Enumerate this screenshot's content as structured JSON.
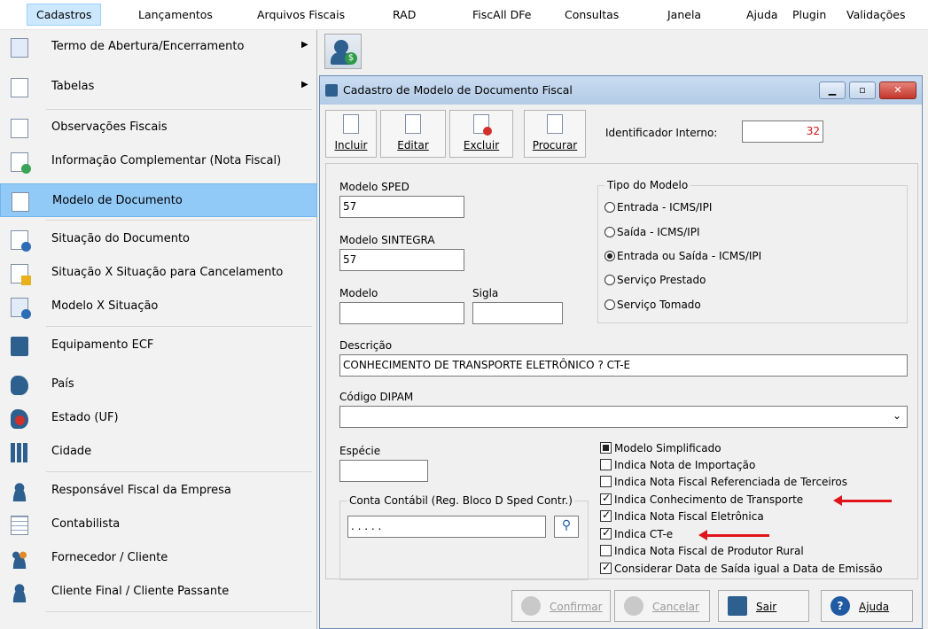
{
  "menubar": {
    "items": [
      "Cadastros",
      "Lançamentos",
      "Arquivos Fiscais",
      "RAD",
      "FiscAll DFe",
      "Consultas",
      "Janela",
      "Ajuda",
      "Plugin",
      "Validações"
    ]
  },
  "menu": {
    "items": [
      {
        "label": "Termo de Abertura/Encerramento"
      },
      {
        "label": "Tabelas"
      },
      {
        "label": "Observações Fiscais"
      },
      {
        "label": "Informação Complementar (Nota Fiscal)"
      },
      {
        "label": "Modelo de Documento"
      },
      {
        "label": "Situação do Documento"
      },
      {
        "label": "Situação X Situação para Cancelamento"
      },
      {
        "label": "Modelo X Situação"
      },
      {
        "label": "Equipamento ECF"
      },
      {
        "label": "País"
      },
      {
        "label": "Estado (UF)"
      },
      {
        "label": "Cidade"
      },
      {
        "label": "Responsável Fiscal da Empresa"
      },
      {
        "label": "Contabilista"
      },
      {
        "label": "Fornecedor / Cliente"
      },
      {
        "label": "Cliente Final / Cliente Passante"
      }
    ]
  },
  "dialog": {
    "title": "Cadastro de Modelo de Documento Fiscal",
    "toolbar": {
      "incluir": "Incluir",
      "editar": "Editar",
      "excluir": "Excluir",
      "procurar": "Procurar"
    },
    "identificador_label": "Identificador Interno:",
    "identificador_value": "32",
    "modelo_sped_label": "Modelo SPED",
    "modelo_sped_value": "57",
    "modelo_sintegra_label": "Modelo SINTEGRA",
    "modelo_sintegra_value": "57",
    "modelo_label": "Modelo",
    "modelo_value": "",
    "sigla_label": "Sigla",
    "sigla_value": "",
    "tipo_label": "Tipo do Modelo",
    "tipo_options": [
      "Entrada - ICMS/IPI",
      "Saída - ICMS/IPI",
      "Entrada ou Saída - ICMS/IPI",
      "Serviço Prestado",
      "Serviço Tomado"
    ],
    "descricao_label": "Descrição",
    "descricao_value": "CONHECIMENTO DE TRANSPORTE ELETRÔNICO ? CT-E",
    "dipam_label": "Código DIPAM",
    "dipam_value": "",
    "especie_label": "Espécie",
    "especie_value": "",
    "conta_label": "Conta Contábil (Reg. Bloco D Sped Contr.)",
    "conta_value": ". . . . .",
    "checks": [
      {
        "label": "Modelo Simplificado",
        "state": "filled"
      },
      {
        "label": "Indica Nota de Importação",
        "state": "off"
      },
      {
        "label": "Indica Nota Fiscal Referenciada de Terceiros",
        "state": "off"
      },
      {
        "label": "Indica Conhecimento de Transporte",
        "state": "on"
      },
      {
        "label": "Indica Nota Fiscal Eletrônica",
        "state": "on"
      },
      {
        "label": "Indica CT-e",
        "state": "on"
      },
      {
        "label": "Indica Nota Fiscal de Produtor Rural",
        "state": "off"
      },
      {
        "label": "Considerar Data de Saída igual a Data de Emissão",
        "state": "on"
      }
    ],
    "buttons": {
      "confirmar": "Confirmar",
      "cancelar": "Cancelar",
      "sair": "Sair",
      "ajuda": "Ajuda"
    }
  }
}
